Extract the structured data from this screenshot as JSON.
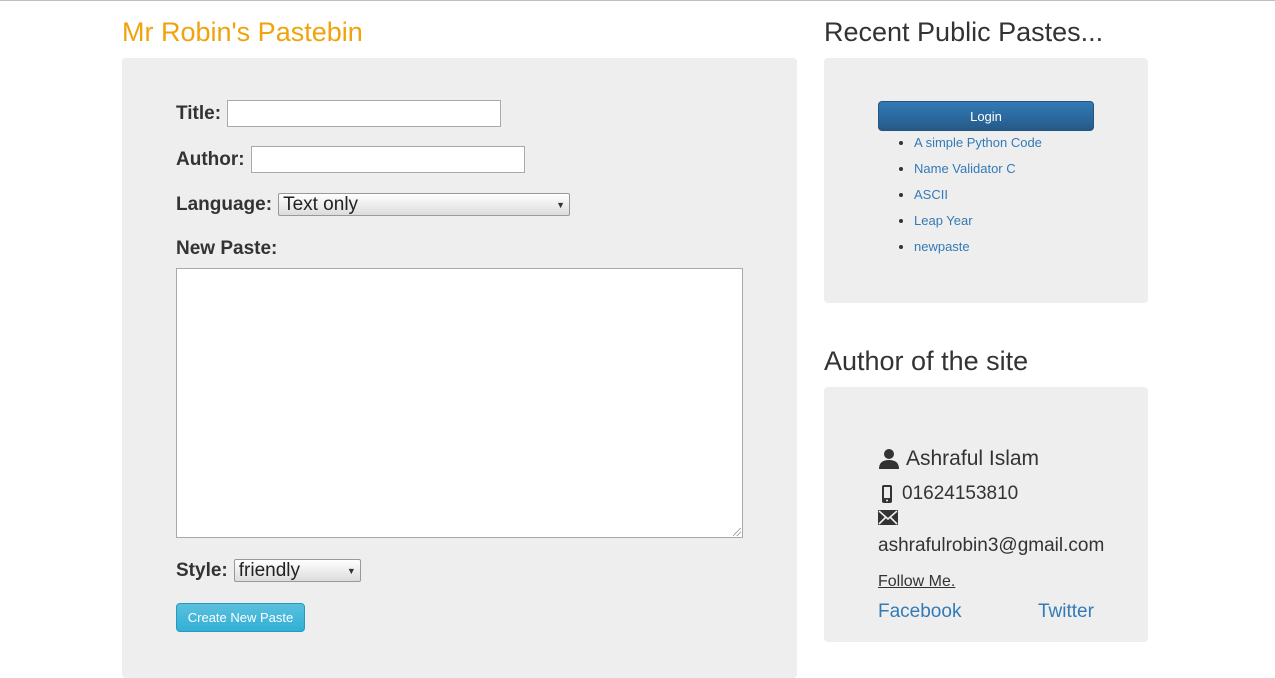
{
  "site": {
    "title": "Mr Robin's Pastebin"
  },
  "form": {
    "title_label": "Title:",
    "title_value": "",
    "author_label": "Author:",
    "author_value": "",
    "language_label": "Language:",
    "language_selected": "Text only",
    "new_paste_label": "New Paste:",
    "paste_value": "",
    "style_label": "Style:",
    "style_selected": "friendly",
    "create_button": "Create New Paste"
  },
  "recent": {
    "heading": "Recent Public Pastes...",
    "login_button": "Login",
    "items": [
      "A simple Python Code",
      "Name Validator C",
      "ASCII",
      "Leap Year",
      "newpaste"
    ]
  },
  "author": {
    "heading": "Author of the site",
    "name": "Ashraful Islam",
    "phone": "01624153810",
    "email": "ashrafulrobin3@gmail.com",
    "follow_label": "Follow Me.",
    "facebook": "Facebook",
    "twitter": "Twitter"
  },
  "colors": {
    "brand": "#f0a30a",
    "link": "#337ab7",
    "panel_bg": "#eeeeee",
    "login_btn": "#337ab7",
    "create_btn": "#5bc0de"
  },
  "icons": {
    "person": "user-icon",
    "phone": "mobile-phone-icon",
    "email": "envelope-icon"
  }
}
